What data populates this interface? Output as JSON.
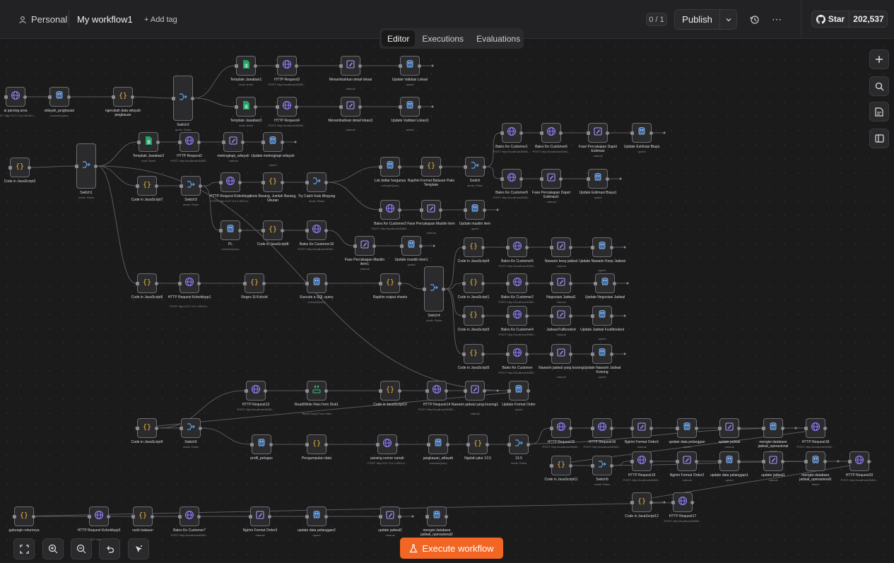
{
  "topbar": {
    "workspace": "Personal",
    "workflow_name": "My workflow1",
    "add_tag": "+ Add tag",
    "version_counter": "0 / 1",
    "publish": "Publish",
    "star": "Star",
    "star_count": "202,537"
  },
  "tabs": {
    "editor": "Editor",
    "executions": "Executions",
    "evaluations": "Evaluations"
  },
  "execute": "Execute workflow",
  "colors": {
    "accent": "#f26522",
    "node_border": "#6d6d72",
    "wire": "#5a5a5e"
  },
  "nodes": [
    {
      "label": "ai parsing area",
      "sub": "POST: http://127.0.0.1:5678/e...",
      "icon": "globe"
    },
    {
      "label": "wilayah_jangkauan",
      "sub": "executeQuery",
      "icon": "postgres"
    },
    {
      "label": "ngerubah data wilayah jangkauan",
      "sub": "",
      "icon": "code"
    },
    {
      "label": "Switch2",
      "sub": "mode: Rules",
      "icon": "switch"
    },
    {
      "label": "Template Jawaban1",
      "sub": "read: sheet",
      "icon": "sheet"
    },
    {
      "label": "HTTP Request3",
      "sub": "POST: http://localhost:8080/...",
      "icon": "globe"
    },
    {
      "label": "Menambahkan detail lokasi",
      "sub": "manual",
      "icon": "edit"
    },
    {
      "label": "Update Validasi Lokasi",
      "sub": "upsert",
      "icon": "postgres"
    },
    {
      "label": "Template Jawaban3",
      "sub": "read: sheet",
      "icon": "sheet"
    },
    {
      "label": "HTTP Request4",
      "sub": "POST: http://localhost:8080/...",
      "icon": "globe"
    },
    {
      "label": "Menambahkan detail lokasi1",
      "sub": "manual",
      "icon": "edit"
    },
    {
      "label": "Update Validasi Lokasi1",
      "sub": "upsert",
      "icon": "postgres"
    },
    {
      "label": "Code in JavaScript2",
      "sub": "",
      "icon": "code"
    },
    {
      "label": "Switch1",
      "sub": "mode: Rules",
      "icon": "switch"
    },
    {
      "label": "Template Jawaban2",
      "sub": "read: sheet",
      "icon": "sheet"
    },
    {
      "label": "HTTP Request2",
      "sub": "POST: http://localhost:8080/...",
      "icon": "globe"
    },
    {
      "label": "melengkapi_wilayah",
      "sub": "manual",
      "icon": "edit"
    },
    {
      "label": "Update melengkapi wilayah",
      "sub": "upsert",
      "icon": "postgres"
    },
    {
      "label": "Bales Ke Customer1",
      "sub": "POST: http://localhost:8080/...",
      "icon": "globe"
    },
    {
      "label": "Bales Ke Customer6",
      "sub": "POST: http://localhost:8080/...",
      "icon": "globe"
    },
    {
      "label": "Fase Percakapan Dapet Estimasi",
      "sub": "manual",
      "icon": "edit"
    },
    {
      "label": "Update Estimasi Biaya",
      "sub": "upsert",
      "icon": "postgres"
    },
    {
      "label": "Code in JavaScript7",
      "sub": "",
      "icon": "code"
    },
    {
      "label": "Switch3",
      "sub": "mode: Rules",
      "icon": "switch"
    },
    {
      "label": "HTTP Request Koboldcpp",
      "sub": "POST: http://127.0.0.1:5001/v...",
      "icon": "globe"
    },
    {
      "label": "Jenis Barang, Jumlah Barang, Ukuran",
      "sub": "",
      "icon": "code"
    },
    {
      "label": "Try Catch Kalo Bingung",
      "sub": "mode: Rules",
      "icon": "switch"
    },
    {
      "label": "List daftar harganya",
      "sub": "executeQuery",
      "icon": "postgres"
    },
    {
      "label": "Rapihin Format Balasan Pake Template",
      "sub": "",
      "icon": "code"
    },
    {
      "label": "Switch",
      "sub": "mode: Rules",
      "icon": "switch"
    },
    {
      "label": "Bales Ke Customer9",
      "sub": "POST: http://localhost:8080/...",
      "icon": "globe"
    },
    {
      "label": "Fase Percakapan Dapet Estimasi1",
      "sub": "manual",
      "icon": "edit"
    },
    {
      "label": "Update Estimasi Biaya1",
      "sub": "upsert",
      "icon": "postgres"
    },
    {
      "label": "Bales Ke Customer3",
      "sub": "POST: http://localhost:8080/...",
      "icon": "globe"
    },
    {
      "label": "Fase Percakapan Mastiin item",
      "sub": "manual",
      "icon": "edit"
    },
    {
      "label": "Update mastiin item",
      "sub": "upsert",
      "icon": "postgres"
    },
    {
      "label": "PL",
      "sub": "executeQuery",
      "icon": "postgres"
    },
    {
      "label": "Code in JavaScript8",
      "sub": "",
      "icon": "code"
    },
    {
      "label": "Bales Ke Customer10",
      "sub": "POST: http://localhost:8080/...",
      "icon": "globe"
    },
    {
      "label": "Fase Percakapan Mastiin item1",
      "sub": "manual",
      "icon": "edit"
    },
    {
      "label": "Update mastiin item1",
      "sub": "upsert",
      "icon": "postgres"
    },
    {
      "label": "Code in JavaScript4",
      "sub": "",
      "icon": "code"
    },
    {
      "label": "Bales Ke Customer5",
      "sub": "POST: http://localhost:8080/...",
      "icon": "globe"
    },
    {
      "label": "Nawarin keep jadwal",
      "sub": "manual",
      "icon": "edit"
    },
    {
      "label": "Update Nawarin Keep Jadwal",
      "sub": "upsert",
      "icon": "postgres"
    },
    {
      "label": "Code in JavaScript6",
      "sub": "",
      "icon": "code"
    },
    {
      "label": "HTTP Request Koboldcpp1",
      "sub": "POST: http://127.0.0.1:5001/v...",
      "icon": "globe"
    },
    {
      "label": "Regex Si Kobold",
      "sub": "",
      "icon": "code"
    },
    {
      "label": "Execute a SQL query",
      "sub": "executeQuery",
      "icon": "postgres"
    },
    {
      "label": "Rapihin output sheets",
      "sub": "",
      "icon": "code"
    },
    {
      "label": "Switch4",
      "sub": "mode: Rules",
      "icon": "switch"
    },
    {
      "label": "Code in JavaScript1",
      "sub": "",
      "icon": "code"
    },
    {
      "label": "Bales Ke Customer2",
      "sub": "POST: http://localhost:8080/...",
      "icon": "globe"
    },
    {
      "label": "Negosiasi Jadwal1",
      "sub": "manual",
      "icon": "edit"
    },
    {
      "label": "Update Negosiasi Jadwal",
      "sub": "upsert",
      "icon": "postgres"
    },
    {
      "label": "Code in JavaScript3",
      "sub": "",
      "icon": "code"
    },
    {
      "label": "Bales Ke Customer4",
      "sub": "POST: http://localhost:8080/...",
      "icon": "globe"
    },
    {
      "label": "Jadwal Fullbooked",
      "sub": "manual",
      "icon": "edit"
    },
    {
      "label": "Update Jadwal Fuullbooked",
      "sub": "upsert",
      "icon": "postgres"
    },
    {
      "label": "Code in JavaScript5",
      "sub": "",
      "icon": "code"
    },
    {
      "label": "Bales Ke Customer",
      "sub": "POST: http://localhost:8080/...",
      "icon": "globe"
    },
    {
      "label": "Nawarin jadwal yang kosong",
      "sub": "manual",
      "icon": "edit"
    },
    {
      "label": "Update Nawarin Jadwal Kosong",
      "sub": "upsert",
      "icon": "postgres"
    },
    {
      "label": "HTTP Request13",
      "sub": "POST: http://localhost:8080/...",
      "icon": "globe"
    },
    {
      "label": "Read/Write Files from Disk1",
      "sub": "Read File(s) From Disk",
      "icon": "file"
    },
    {
      "label": "Code in JavaScript10",
      "sub": "",
      "icon": "code"
    },
    {
      "label": "HTTP Request14",
      "sub": "POST: http://localhost:8080/...",
      "icon": "globe"
    },
    {
      "label": "Nawarin jadwal yang kosong1",
      "sub": "manual",
      "icon": "edit"
    },
    {
      "label": "Update Format Order",
      "sub": "upsert",
      "icon": "postgres"
    },
    {
      "label": "Code in JavaScript9",
      "sub": "",
      "icon": "code"
    },
    {
      "label": "Switch5",
      "sub": "mode: Rules",
      "icon": "switch"
    },
    {
      "label": "profil_petugas",
      "sub": "",
      "icon": "postgres"
    },
    {
      "label": "Pengumpulan data",
      "sub": "",
      "icon": "code"
    },
    {
      "label": "parsing nomor rumah",
      "sub": "POST: http://127.0.0.1:5001/v...",
      "icon": "globe"
    },
    {
      "label": "jangkauan_wilayah",
      "sub": "executeQuery",
      "icon": "postgres"
    },
    {
      "label": "Ngolah jalur 13.5",
      "sub": "",
      "icon": "code"
    },
    {
      "label": "13.5",
      "sub": "mode: Rules",
      "icon": "switch"
    },
    {
      "label": "HTTP Request15",
      "sub": "POST: http://localhost:8080/...",
      "icon": "globe"
    },
    {
      "label": "HTTP Request16",
      "sub": "POST: http://localhost:8080/...",
      "icon": "globe"
    },
    {
      "label": "Ngirim Format Order1",
      "sub": "manual",
      "icon": "edit"
    },
    {
      "label": "update data pelanggan",
      "sub": "upsert",
      "icon": "postgres"
    },
    {
      "label": "update jadwal",
      "sub": "manual",
      "icon": "edit"
    },
    {
      "label": "mengisi database jadwal_operasional",
      "sub": "insert",
      "icon": "postgres"
    },
    {
      "label": "HTTP Request18",
      "sub": "POST: http://localhost:8080/...",
      "icon": "globe"
    },
    {
      "label": "Code in JavaScript11",
      "sub": "",
      "icon": "code"
    },
    {
      "label": "Switch6",
      "sub": "mode: Rules",
      "icon": "switch"
    },
    {
      "label": "HTTP Request19",
      "sub": "POST: http://localhost:8080/...",
      "icon": "globe"
    },
    {
      "label": "Ngirim Format Order2",
      "sub": "manual",
      "icon": "edit"
    },
    {
      "label": "update data pelanggan1",
      "sub": "upsert",
      "icon": "postgres"
    },
    {
      "label": "update jadwal1",
      "sub": "manual",
      "icon": "edit"
    },
    {
      "label": "mengisi database jadwal_operasional1",
      "sub": "insert",
      "icon": "postgres"
    },
    {
      "label": "HTTP Request20",
      "sub": "POST: http://localhost:8080/...",
      "icon": "globe"
    },
    {
      "label": "Code in JavaScript12",
      "sub": "",
      "icon": "code"
    },
    {
      "label": "HTTP Request17",
      "sub": "POST: http://localhost:8080/...",
      "icon": "globe"
    },
    {
      "label": "gabungin returnnya",
      "sub": "",
      "icon": "code"
    },
    {
      "label": "HTTP Request Koboldcpp3",
      "sub": "POST: http://127...",
      "icon": "globe"
    },
    {
      "label": "racik balasan",
      "sub": "",
      "icon": "code"
    },
    {
      "label": "Bales Ke Customer7",
      "sub": "POST: http://localhost:8080/...",
      "icon": "globe"
    },
    {
      "label": "Ngirim Format Order3",
      "sub": "manual",
      "icon": "edit"
    },
    {
      "label": "update data pelanggan2",
      "sub": "upsert",
      "icon": "postgres"
    },
    {
      "label": "update jadwal2",
      "sub": "manual",
      "icon": "edit"
    },
    {
      "label": "mengisi database jadwal_operasional2",
      "sub": "insert",
      "icon": "postgres"
    }
  ]
}
